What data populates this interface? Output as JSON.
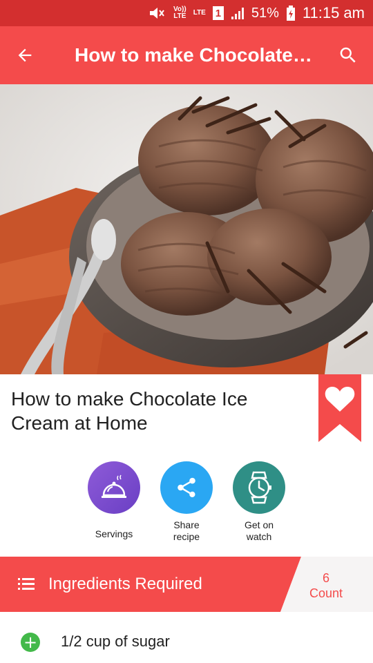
{
  "status_bar": {
    "network_label_top": "Vo))",
    "network_label_bottom": "LTE",
    "lte_label": "LTE",
    "sim_slot": "1",
    "battery_percent": "51%",
    "time": "11:15 am",
    "icons": [
      "mute-icon",
      "signal-icon",
      "battery-charging-icon"
    ]
  },
  "app_bar": {
    "title": "How to make Chocolate…",
    "back_icon": "arrow-back-icon",
    "search_icon": "search-icon"
  },
  "hero": {
    "subject": "chocolate-ice-cream-bowl-image"
  },
  "recipe": {
    "title": "How to make Chocolate Ice Cream at Home",
    "favorite_icon": "heart-icon"
  },
  "actions": [
    {
      "label": "Servings",
      "icon": "cloche-icon",
      "color": "#7e4fd0"
    },
    {
      "label": "Share recipe",
      "icon": "share-icon",
      "color": "#2aa7f3"
    },
    {
      "label": "Get on watch",
      "icon": "watch-icon",
      "color": "#2f8f86"
    }
  ],
  "ingredients": {
    "header_label": "Ingredients Required",
    "count_value": "6",
    "count_label": "Count",
    "items": [
      {
        "text": "1/2 cup of sugar"
      }
    ]
  },
  "colors": {
    "status_bar": "#d32f2f",
    "primary": "#f44b4b",
    "add_green": "#43b94a"
  }
}
